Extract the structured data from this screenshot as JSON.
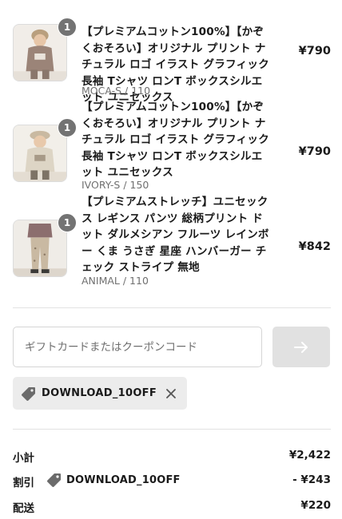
{
  "cart": {
    "items": [
      {
        "quantity": "1",
        "title": "【プレミアムコットン100%】【かぞくおそろい】オリジナル プリント ナチュラル ロゴ イラスト グラフィック 長袖 Tシャツ ロンT ボックスシルエット ユニセックス",
        "variant": "MOCA-S / 110",
        "price": "¥790"
      },
      {
        "quantity": "1",
        "title": "【プレミアムコットン100%】【かぞくおそろい】オリジナル プリント ナチュラル ロゴ イラスト グラフィック 長袖 Tシャツ ロンT ボックスシルエット ユニセックス",
        "variant": "IVORY-S / 150",
        "price": "¥790"
      },
      {
        "quantity": "1",
        "title": "【プレミアムストレッチ】ユニセックス レギンス パンツ 総柄プリント ドット ダルメシアン フルーツ レインボー くま うさぎ 星座 ハンバーガー チェック ストライプ 無地",
        "variant": "ANIMAL / 110",
        "price": "¥842"
      }
    ]
  },
  "coupon": {
    "placeholder": "ギフトカードまたはクーポンコード",
    "value": "",
    "apply_icon": "arrow-right-icon",
    "applied_code": "DOWNLOAD_10OFF",
    "tag_icon": "tag-icon",
    "remove_icon": "close-icon"
  },
  "summary": {
    "subtotal_label": "小計",
    "subtotal_value": "¥2,422",
    "discount_label": "割引",
    "discount_code": "DOWNLOAD_10OFF",
    "discount_value": "- ¥243",
    "shipping_label": "配送",
    "shipping_value": "¥220"
  },
  "colors": {
    "text": "#1a1a1a",
    "muted": "#707070",
    "badge": "#737373",
    "apply_button": "#e1e1e1",
    "tag_background": "#ececec",
    "divider": "#e2e2e2"
  }
}
